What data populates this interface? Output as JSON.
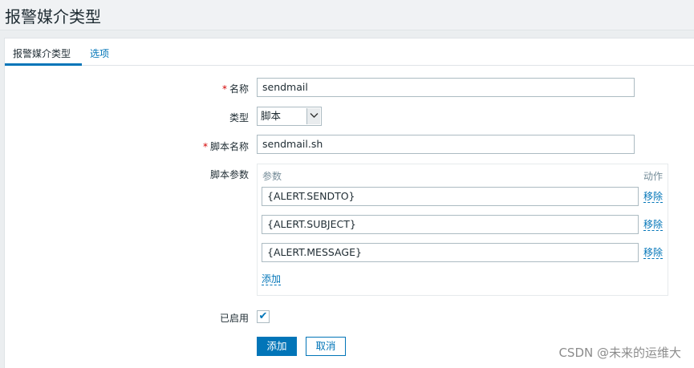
{
  "page": {
    "title": "报警媒介类型"
  },
  "tabs": [
    {
      "label": "报警媒介类型",
      "active": true
    },
    {
      "label": "选项",
      "active": false
    }
  ],
  "form": {
    "name": {
      "label": "名称",
      "required_mark": "*",
      "value": "sendmail"
    },
    "type": {
      "label": "类型",
      "selected": "脚本"
    },
    "script_name": {
      "label": "脚本名称",
      "required_mark": "*",
      "value": "sendmail.sh"
    },
    "script_params": {
      "label": "脚本参数",
      "header_param": "参数",
      "header_action": "动作",
      "rows": [
        {
          "value": "{ALERT.SENDTO}",
          "action": "移除"
        },
        {
          "value": "{ALERT.SUBJECT}",
          "action": "移除"
        },
        {
          "value": "{ALERT.MESSAGE}",
          "action": "移除"
        }
      ],
      "add_label": "添加"
    },
    "enabled": {
      "label": "已启用",
      "checked": true,
      "check_glyph": "✔"
    }
  },
  "buttons": {
    "add": "添加",
    "cancel": "取消"
  },
  "watermark": "CSDN @未来的运维大",
  "colors": {
    "accent": "#0275b8",
    "required": "#d40000",
    "muted": "#768d99"
  }
}
